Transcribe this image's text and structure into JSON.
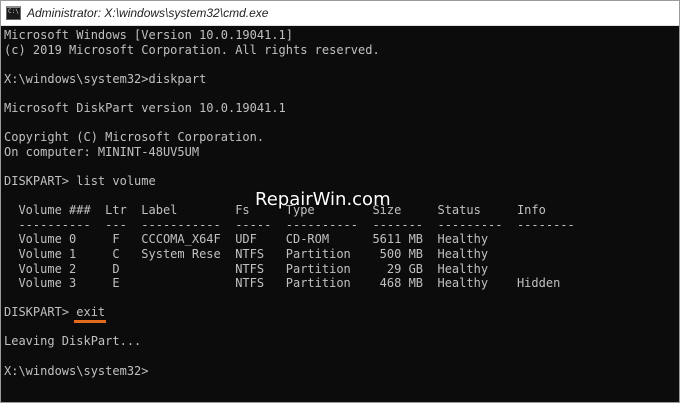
{
  "window": {
    "title": "Administrator: X:\\windows\\system32\\cmd.exe",
    "icon": "cmd-icon"
  },
  "console": {
    "lines": [
      "Microsoft Windows [Version 10.0.19041.1]",
      "(c) 2019 Microsoft Corporation. All rights reserved.",
      "",
      "X:\\windows\\system32>diskpart",
      "",
      "Microsoft DiskPart version 10.0.19041.1",
      "",
      "Copyright (C) Microsoft Corporation.",
      "On computer: MININT-48UV5UM",
      "",
      "DISKPART> list volume",
      "",
      "  Volume ###  Ltr  Label        Fs     Type        Size     Status     Info",
      "  ----------  ---  -----------  -----  ----------  -------  ---------  --------",
      "  Volume 0     F   CCCOMA_X64F  UDF    CD-ROM      5611 MB  Healthy",
      "  Volume 1     C   System Rese  NTFS   Partition    500 MB  Healthy",
      "  Volume 2     D                NTFS   Partition     29 GB  Healthy",
      "  Volume 3     E                NTFS   Partition    468 MB  Healthy    Hidden",
      "",
      "DISKPART> exit",
      "",
      "Leaving DiskPart...",
      "",
      "X:\\windows\\system32>"
    ]
  },
  "watermark": "RepairWin.com",
  "colors": {
    "console_bg": "#0c0c0c",
    "console_text": "#c0c0c0",
    "highlight_underline": "#e46a1c"
  }
}
